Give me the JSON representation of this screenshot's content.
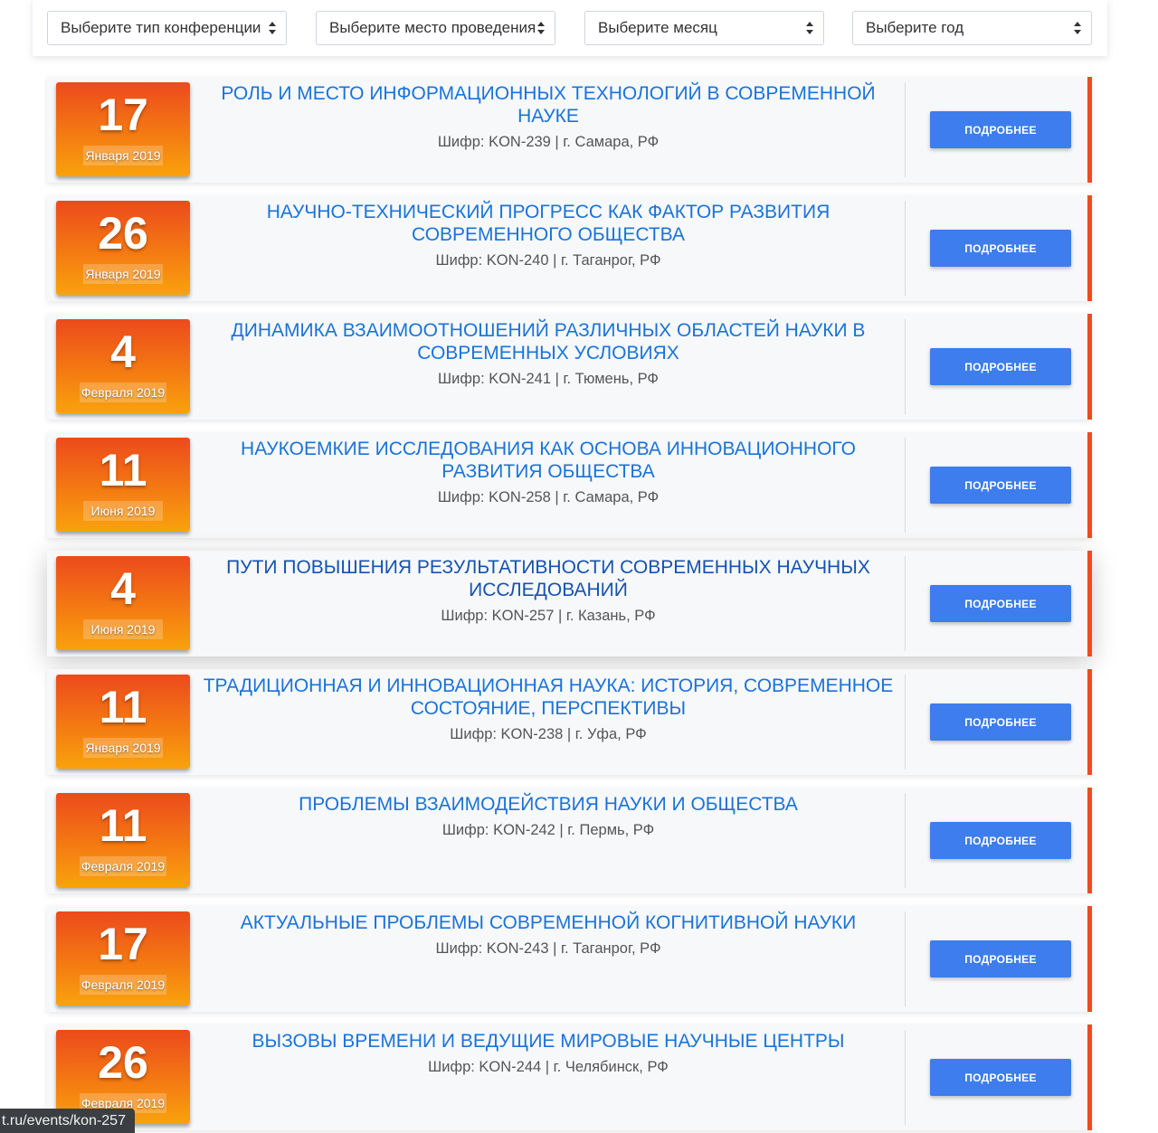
{
  "filters": [
    {
      "label": "Выберите тип конференции"
    },
    {
      "label": "Выберите место проведения"
    },
    {
      "label": "Выберите месяц"
    },
    {
      "label": "Выберите год"
    }
  ],
  "conferences": [
    {
      "day": "17",
      "month_year": "Января 2019",
      "title": "РОЛЬ И МЕСТО ИНФОРМАЦИОННЫХ ТЕХНОЛОГИЙ В СОВРЕМЕННОЙ НАУКЕ",
      "meta": "Шифр: KON-239 | г. Самара, РФ",
      "button": "ПОДРОБНЕЕ"
    },
    {
      "day": "26",
      "month_year": "Января 2019",
      "title": "НАУЧНО-ТЕХНИЧЕСКИЙ ПРОГРЕСС КАК ФАКТОР РАЗВИТИЯ СОВРЕМЕННОГО ОБЩЕСТВА",
      "meta": "Шифр: KON-240 | г. Таганрог, РФ",
      "button": "ПОДРОБНЕЕ"
    },
    {
      "day": "4",
      "month_year": "Февраля 2019",
      "title": "ДИНАМИКА ВЗАИМООТНОШЕНИЙ РАЗЛИЧНЫХ ОБЛАСТЕЙ НАУКИ В СОВРЕМЕННЫХ УСЛОВИЯХ",
      "meta": "Шифр: KON-241 | г. Тюмень, РФ",
      "button": "ПОДРОБНЕЕ"
    },
    {
      "day": "11",
      "month_year": "Июня 2019",
      "title": "НАУКОЕМКИЕ ИССЛЕДОВАНИЯ КАК ОСНОВА ИННОВАЦИОННОГО РАЗВИТИЯ ОБЩЕСТВА",
      "meta": "Шифр: KON-258 | г. Самара, РФ",
      "button": "ПОДРОБНЕЕ"
    },
    {
      "day": "4",
      "month_year": "Июня 2019",
      "title": "ПУТИ ПОВЫШЕНИЯ РЕЗУЛЬТАТИВНОСТИ СОВРЕМЕННЫХ НАУЧНЫХ ИССЛЕДОВАНИЙ",
      "meta": "Шифр: KON-257 | г. Казань, РФ",
      "button": "ПОДРОБНЕЕ"
    },
    {
      "day": "11",
      "month_year": "Января 2019",
      "title": "ТРАДИЦИОННАЯ И ИННОВАЦИОННАЯ НАУКА: ИСТОРИЯ, СОВРЕМЕННОЕ СОСТОЯНИЕ, ПЕРСПЕКТИВЫ",
      "meta": "Шифр: KON-238 | г. Уфа, РФ",
      "button": "ПОДРОБНЕЕ"
    },
    {
      "day": "11",
      "month_year": "Февраля 2019",
      "title": "ПРОБЛЕМЫ ВЗАИМОДЕЙСТВИЯ НАУКИ И ОБЩЕСТВА",
      "meta": "Шифр: KON-242 | г. Пермь, РФ",
      "button": "ПОДРОБНЕЕ"
    },
    {
      "day": "17",
      "month_year": "Февраля 2019",
      "title": "АКТУАЛЬНЫЕ ПРОБЛЕМЫ СОВРЕМЕННОЙ КОГНИТИВНОЙ НАУКИ",
      "meta": "Шифр: KON-243 | г. Таганрог, РФ",
      "button": "ПОДРОБНЕЕ"
    },
    {
      "day": "26",
      "month_year": "Февраля 2019",
      "title": "ВЫЗОВЫ ВРЕМЕНИ И ВЕДУЩИЕ МИРОВЫЕ НАУЧНЫЕ ЦЕНТРЫ",
      "meta": "Шифр: KON-244 | г. Челябинск, РФ",
      "button": "ПОДРОБНЕЕ"
    }
  ],
  "status_bar": {
    "url": "t.ru/events/kon-257"
  },
  "colors": {
    "accent": "#ef4b1f",
    "button": "#3d7ded",
    "title": "#1a73d9"
  },
  "icons": {
    "select_arrow": "updown-chevron-icon"
  }
}
